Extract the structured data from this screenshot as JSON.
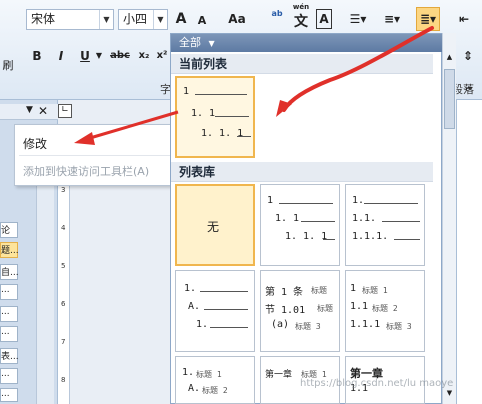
{
  "ribbon": {
    "font_name": "宋体",
    "font_size": "小四",
    "grow_font": "A",
    "shrink_font": "A",
    "change_case": "Aa",
    "pinyin_label": "wén",
    "pinyin_char": "文",
    "char_border": "A",
    "bold": "B",
    "italic": "I",
    "underline": "U",
    "strikethrough": "abc",
    "subscript": "x₂",
    "superscript": "x²",
    "group_font_partial": "字",
    "group_paragraph": "段落",
    "left_edge_text": "刷"
  },
  "context_menu": {
    "items": [
      {
        "label": "修改",
        "enabled": true
      },
      {
        "label": "添加到快速访问工具栏(A)",
        "enabled": false
      }
    ]
  },
  "gallery": {
    "filter_label": "全部",
    "section_current": "当前列表",
    "section_library": "列表库",
    "none_label": "无",
    "current_tile": [
      "1",
      "1. 1",
      "1. 1. 1"
    ],
    "library_tiles": [
      {
        "lines": [
          "1",
          "1. 1",
          "1. 1. 1"
        ]
      },
      {
        "lines": [
          "1.",
          "1.1.",
          "1.1.1."
        ]
      },
      {
        "lines": [
          "1.",
          "A.",
          "1."
        ]
      },
      {
        "lines": [
          "第 1 条",
          "标题",
          "节 1.01",
          "标题",
          "(a)",
          "标题 3"
        ]
      },
      {
        "lines": [
          "1",
          "标题 1",
          "1.1",
          "标题 2",
          "1.1.1",
          "标题 3"
        ]
      },
      {
        "lines": [
          "1.",
          "标题 1",
          "A.",
          "标题 2"
        ]
      },
      {
        "lines": [
          "第一章",
          "标题 1"
        ]
      },
      {
        "lines": [
          "第一章",
          "1.1"
        ]
      }
    ]
  },
  "ruler": {
    "marks": [
      "3",
      "4",
      "5",
      "6",
      "7",
      "8"
    ]
  },
  "sidebar": {
    "items": [
      "论",
      "题...",
      "自...",
      "...",
      "...",
      "...",
      "表...",
      "...",
      "...",
      "..."
    ]
  },
  "watermark": "https://blog.csdn.net/lu maoye",
  "colors": {
    "arrow": "#e0302a",
    "selection": "#f0b64e"
  }
}
